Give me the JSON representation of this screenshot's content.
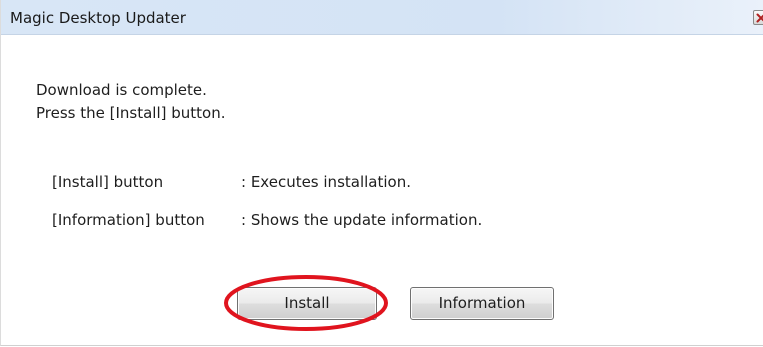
{
  "window": {
    "title": "Magic Desktop Updater",
    "close_icon": "close-icon"
  },
  "message": {
    "line1": "Download is complete.",
    "line2": "Press the [Install] button."
  },
  "info_rows": [
    {
      "label": "[Install] button",
      "description": ": Executes installation."
    },
    {
      "label": "[Information] button",
      "description": ": Shows the update information."
    }
  ],
  "buttons": {
    "install_label": "Install",
    "information_label": "Information"
  },
  "annotation": {
    "highlight_color": "#e0141e",
    "highlight_target": "install-button"
  }
}
